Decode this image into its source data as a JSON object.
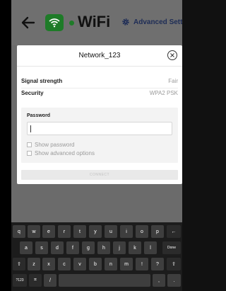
{
  "header": {
    "title": "WiFi",
    "advanced_settings": "Advanced Settings"
  },
  "dialog": {
    "title": "Network_123",
    "signal_label": "Signal strength",
    "signal_value": "Fair",
    "security_label": "Security",
    "security_value": "WPA2 PSK",
    "password_label": "Password",
    "password_value": "",
    "show_password": "Show password",
    "show_advanced": "Show advanced options",
    "connect": "CONNECT"
  },
  "keyboard": {
    "row1": [
      "q",
      "w",
      "e",
      "r",
      "t",
      "y",
      "u",
      "i",
      "o",
      "p",
      "←"
    ],
    "row2": [
      "a",
      "s",
      "d",
      "f",
      "g",
      "h",
      "j",
      "k",
      "l",
      "Done"
    ],
    "row3": [
      "⇧",
      "z",
      "x",
      "c",
      "v",
      "b",
      "n",
      "m",
      "!",
      "?",
      "⇧"
    ],
    "row4": [
      "?123",
      "⌗",
      "/",
      "",
      ",",
      "."
    ]
  },
  "colors": {
    "accent_green": "#1e7b28",
    "link_blue": "#1d2c56"
  }
}
